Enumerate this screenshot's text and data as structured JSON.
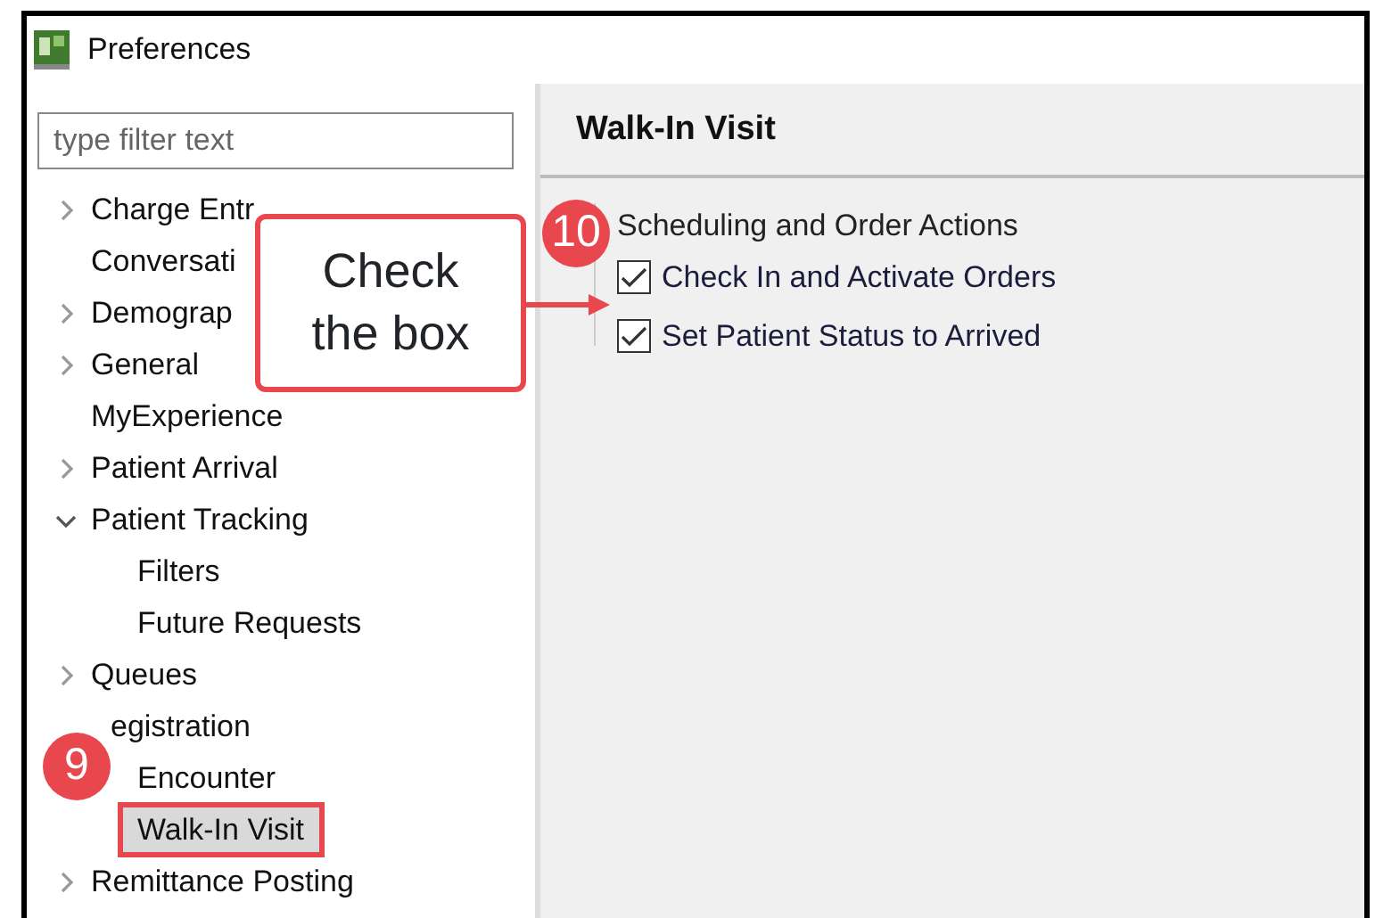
{
  "window": {
    "title": "Preferences"
  },
  "filter": {
    "placeholder": "type filter text"
  },
  "tree": [
    {
      "label": "Charge Entr",
      "expanded": false
    },
    {
      "label": "Conversati"
    },
    {
      "label": "Demograp",
      "expanded": false
    },
    {
      "label": "General",
      "expanded": false
    },
    {
      "label": "MyExperience"
    },
    {
      "label": "Patient Arrival",
      "expanded": false
    },
    {
      "label": "Patient Tracking",
      "expanded": true,
      "children": [
        {
          "label": "Filters",
          "selected": false
        },
        {
          "label": "Future Requests",
          "selected": false
        }
      ]
    },
    {
      "label": "Queues",
      "expanded": false
    },
    {
      "label": "egistration",
      "children": [
        {
          "label": "Encounter",
          "selected": false
        },
        {
          "label": "Walk-In Visit",
          "selected": true
        }
      ]
    },
    {
      "label": "Remittance Posting",
      "expanded": false
    }
  ],
  "page": {
    "title": "Walk-In Visit",
    "group": "Scheduling and Order Actions",
    "options": [
      {
        "label": "Check In and Activate Orders",
        "checked": true
      },
      {
        "label": "Set Patient Status to Arrived",
        "checked": true
      }
    ]
  },
  "annotations": [
    {
      "kind": "callout",
      "text": "Check the box"
    },
    {
      "kind": "step",
      "text": "10"
    },
    {
      "kind": "step",
      "text": "9"
    }
  ]
}
